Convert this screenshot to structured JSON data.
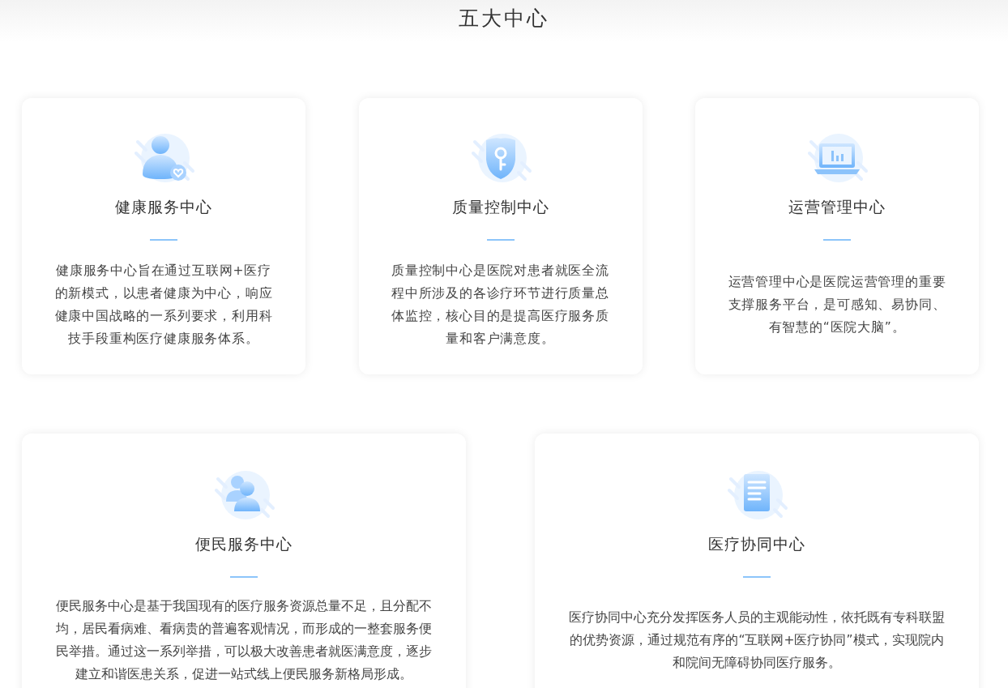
{
  "title": "五大中心",
  "rows": [
    [
      {
        "kind": "person-heart",
        "title": "健康服务中心",
        "description": "健康服务中心旨在通过互联网+医疗的新模式，以患者健康为中心，响应健康中国战略的一系列要求，利用科技手段重构医疗健康服务体系。"
      },
      {
        "kind": "shield-key",
        "title": "质量控制中心",
        "description": "质量控制中心是医院对患者就医全流程中所涉及的各诊疗环节进行质量总体监控，核心目的是提高医疗服务质量和客户满意度。"
      },
      {
        "kind": "laptop-chart",
        "title": "运营管理中心",
        "description": "运营管理中心是医院运营管理的重要支撑服务平台，是可感知、易协同、有智慧的“医院大脑”。"
      }
    ],
    [
      {
        "kind": "two-people",
        "title": "便民服务中心",
        "description": "便民服务中心是基于我国现有的医疗服务资源总量不足，且分配不均，居民看病难、看病贵的普遍客观情况，而形成的一整套服务便民举措。通过这一系列举措，可以极大改善患者就医满意度，逐步建立和谐医患关系，促进一站式线上便民服务新格局形成。"
      },
      {
        "kind": "document",
        "title": "医疗协同中心",
        "description": "医疗协同中心充分发挥医务人员的主观能动性，依托既有专科联盟的优势资源，通过规范有序的“互联网+医疗协同”模式，实现院内和院间无障碍协同医疗服务。"
      }
    ]
  ]
}
